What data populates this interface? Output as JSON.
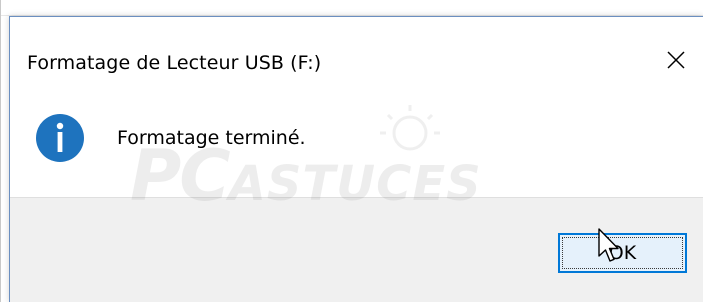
{
  "dialog": {
    "title": "Formatage de Lecteur USB (F:)",
    "message": "Formatage terminé.",
    "ok_label": "OK",
    "close_symbol": "✕"
  },
  "icons": {
    "close": "close-icon",
    "info": "info-icon",
    "cursor": "mouse-pointer-icon"
  },
  "watermark": {
    "part1": "PC",
    "part2": "ASTUCES"
  },
  "colors": {
    "info_icon": "#1e73be",
    "ok_border": "#0078d7",
    "ok_background": "#e5f1fb",
    "footer_background": "#f0f0f0",
    "dialog_border": "#6b8fc0"
  }
}
